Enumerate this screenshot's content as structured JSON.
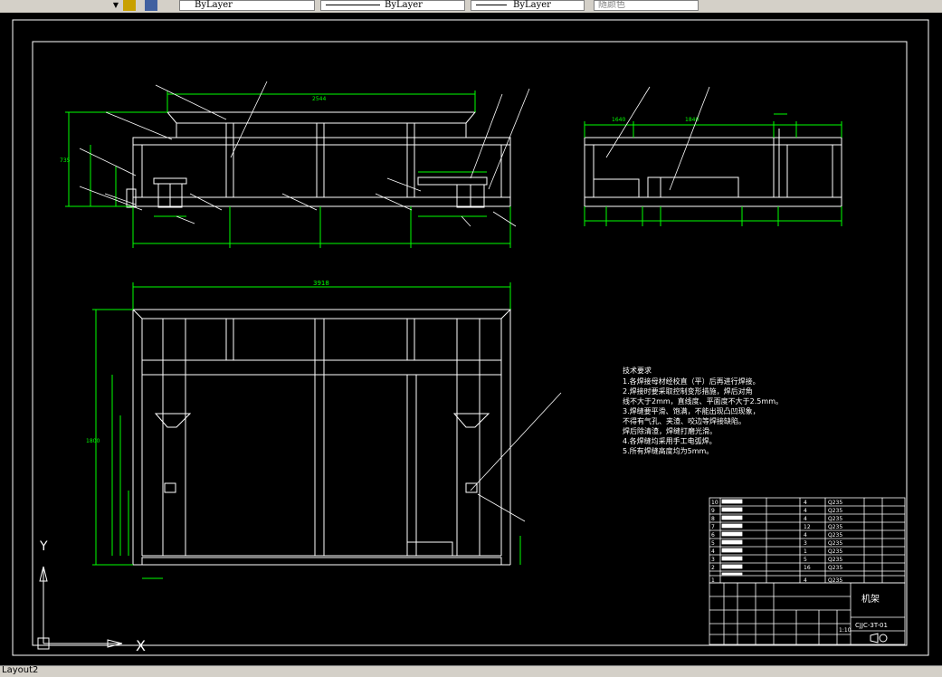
{
  "toolbar": {
    "linetype_value": "ByLayer",
    "lineweight_value": "ByLayer",
    "plotstyle_value": "ByLayer",
    "color_value": "随颜色"
  },
  "layout_tab": "Layout2",
  "notes": {
    "heading": "技术要求",
    "lines": [
      "1.各焊接母材经校直（平）后再进行焊接。",
      "2.焊接时要采取控制变形措施，焊后对角",
      "线不大于2mm，直线度、平面度不大于2.5mm。",
      "3.焊缝要平滑、饱满，不能出现凸凹现象，",
      "不得有气孔、夹渣、咬边等焊接缺陷。",
      "焊后除清渣，焊缝打磨光滑。",
      "4.各焊缝均采用手工电弧焊。",
      "5.所有焊缝高度均为5mm。"
    ]
  },
  "dims": {
    "front_top": "2544",
    "front_height": "735",
    "plan_width": "3918",
    "plan_height": "1800",
    "side_a": "1640",
    "side_b": "1840"
  },
  "parts": [
    {
      "no": "10",
      "mat": "Q235",
      "qty": "4"
    },
    {
      "no": "9",
      "mat": "Q235",
      "qty": "4"
    },
    {
      "no": "8",
      "mat": "Q235",
      "qty": "4"
    },
    {
      "no": "7",
      "mat": "Q235",
      "qty": "12"
    },
    {
      "no": "6",
      "mat": "Q235",
      "qty": "4"
    },
    {
      "no": "5",
      "mat": "Q235",
      "qty": "3"
    },
    {
      "no": "4",
      "mat": "Q235",
      "qty": "1"
    },
    {
      "no": "3",
      "mat": "Q235",
      "qty": "5"
    },
    {
      "no": "2",
      "mat": "Q235",
      "qty": "16"
    },
    {
      "no": "1",
      "mat": "Q235",
      "qty": "4"
    }
  ],
  "title_block": {
    "name": "机架",
    "code": "CJJC-3T-01",
    "scale": "1:10"
  },
  "ucs": {
    "x_label": "X",
    "y_label": "Y"
  }
}
